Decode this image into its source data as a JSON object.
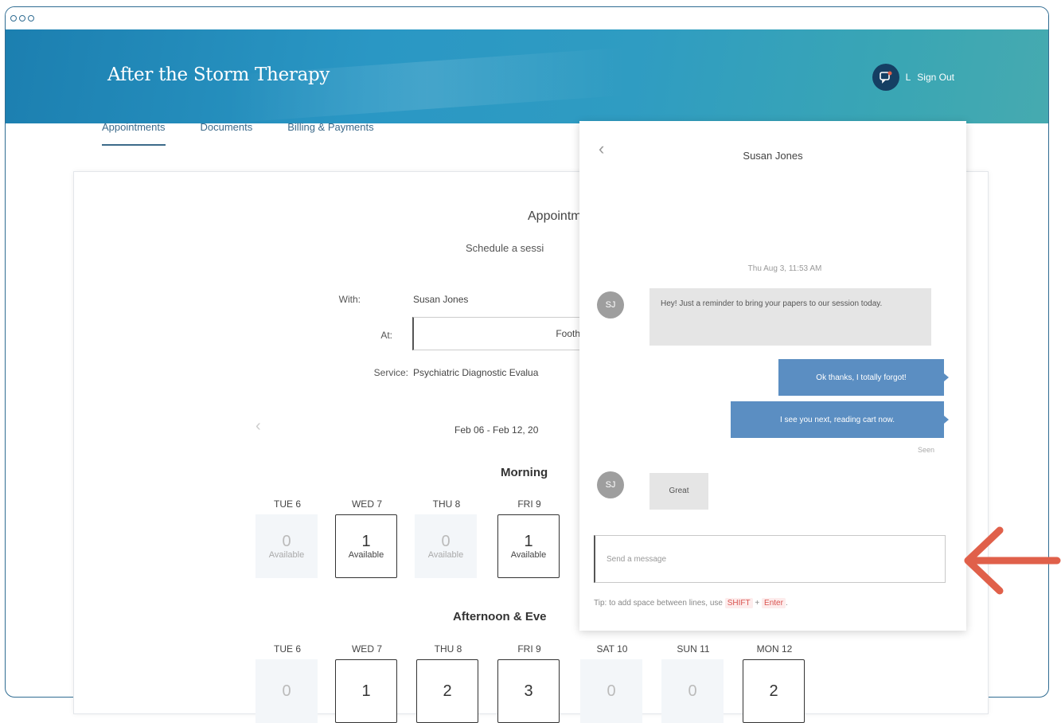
{
  "window": {
    "controls": [
      "",
      "",
      ""
    ]
  },
  "header": {
    "title": "After the Storm Therapy",
    "signout_label": "Sign Out",
    "user_initial": "L"
  },
  "nav": {
    "tabs": [
      "Appointments",
      "Documents",
      "Billing & Payments"
    ]
  },
  "appointment": {
    "title": "Appointment",
    "subtitle": "Schedule a sessi",
    "with_label": "With:",
    "with_value": "Susan Jones",
    "at_label": "At:",
    "at_value": "Foothill",
    "service_label": "Service:",
    "service_value": "Psychiatric Diagnostic Evalua",
    "week_range": "Feb 06 - Feb 12, 20",
    "morning_label": "Morning",
    "afternoon_label": "Afternoon & Eve",
    "available_label": "Available",
    "morning_days": [
      {
        "day": "TUE 6",
        "count": "0",
        "available": false
      },
      {
        "day": "WED 7",
        "count": "1",
        "available": true
      },
      {
        "day": "THU 8",
        "count": "0",
        "available": false
      },
      {
        "day": "FRI 9",
        "count": "1",
        "available": true
      }
    ],
    "afternoon_days": [
      {
        "day": "TUE 6",
        "count": "0",
        "available": false
      },
      {
        "day": "WED 7",
        "count": "1",
        "available": true
      },
      {
        "day": "THU 8",
        "count": "2",
        "available": true
      },
      {
        "day": "FRI 9",
        "count": "3",
        "available": true
      },
      {
        "day": "SAT 10",
        "count": "0",
        "available": false
      },
      {
        "day": "SUN 11",
        "count": "0",
        "available": false
      },
      {
        "day": "MON 12",
        "count": "2",
        "available": true
      }
    ]
  },
  "chat": {
    "contact_name": "Susan Jones",
    "timestamp": "Thu Aug 3, 11:53 AM",
    "avatar_initials": "SJ",
    "messages": {
      "m1": "Hey! Just a reminder to bring your papers to our session today.",
      "m2": "Ok thanks, I totally forgot!",
      "m3": "I see you next, reading cart now.",
      "m4": "Great"
    },
    "seen_label": "Seen",
    "input_placeholder": "Send a message",
    "tip_prefix": "Tip: to add space between lines, use",
    "tip_key1": "SHIFT",
    "tip_plus": "+",
    "tip_key2": "Enter",
    "tip_suffix": "."
  },
  "colors": {
    "header": "#2a97c4",
    "bubble_out": "#5b8ec2",
    "annotation_arrow": "#e0604a"
  }
}
